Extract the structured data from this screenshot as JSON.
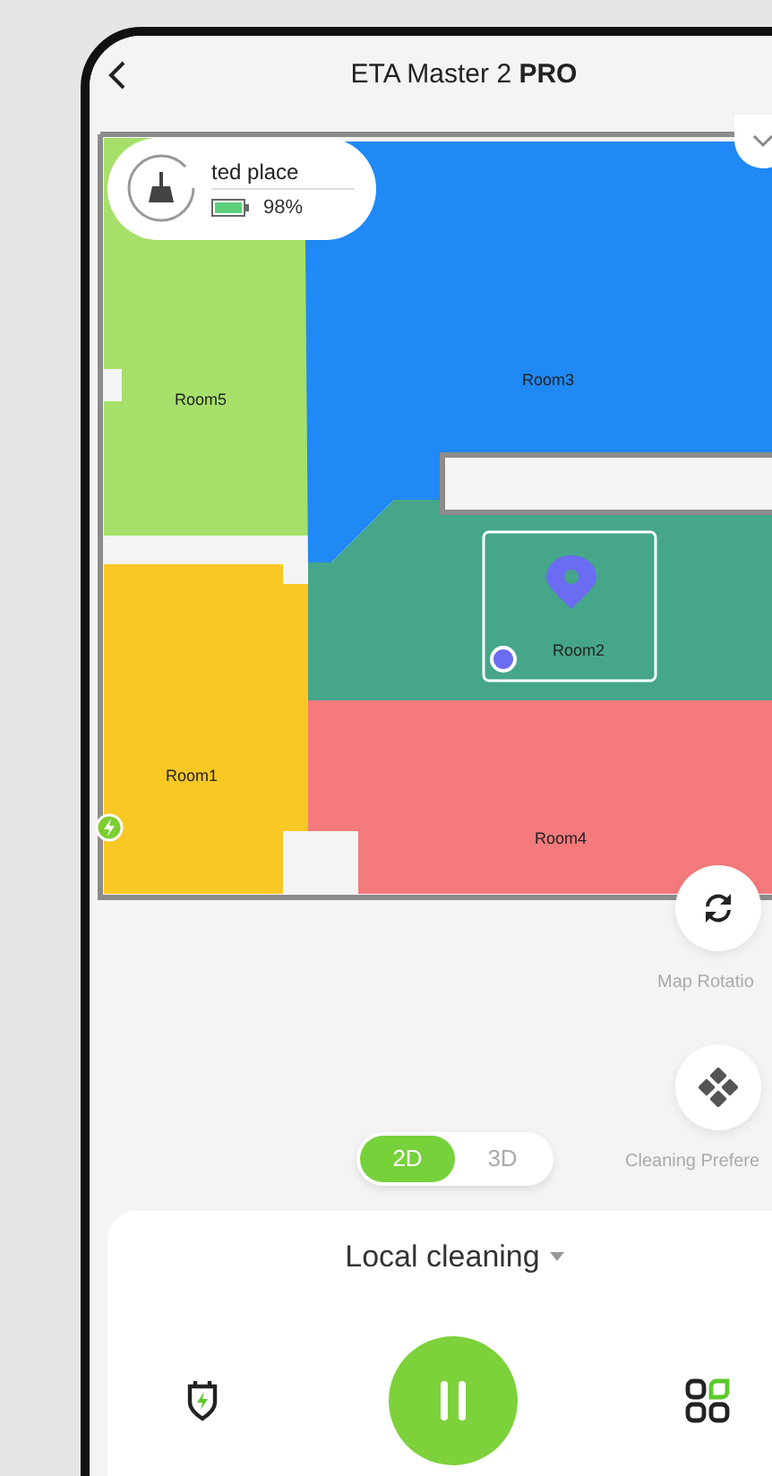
{
  "header": {
    "title": "ETA Master 2 **PRO**"
  },
  "device": {
    "name": "ted place",
    "battery": "98%"
  },
  "map": {
    "rooms": [
      {
        "name": "Room5",
        "color": "#a6e06a"
      },
      {
        "name": "Room3",
        "color": "#2089f5"
      },
      {
        "name": "Room2",
        "color": "#46a68a"
      },
      {
        "name": "Room1",
        "color": "#f9c825"
      },
      {
        "name": "Room4",
        "color": "#f47a7c"
      }
    ]
  },
  "side_buttons": [
    {
      "kind": "rotate",
      "label": "Map Rotatio"
    },
    {
      "kind": "preferences",
      "label": "Cleaning Prefere"
    }
  ],
  "view_toggle": [
    {
      "label": "2D",
      "selected": true
    },
    {
      "label": "3D",
      "selected": false
    }
  ],
  "mode": {
    "label": "Local cleaning"
  }
}
